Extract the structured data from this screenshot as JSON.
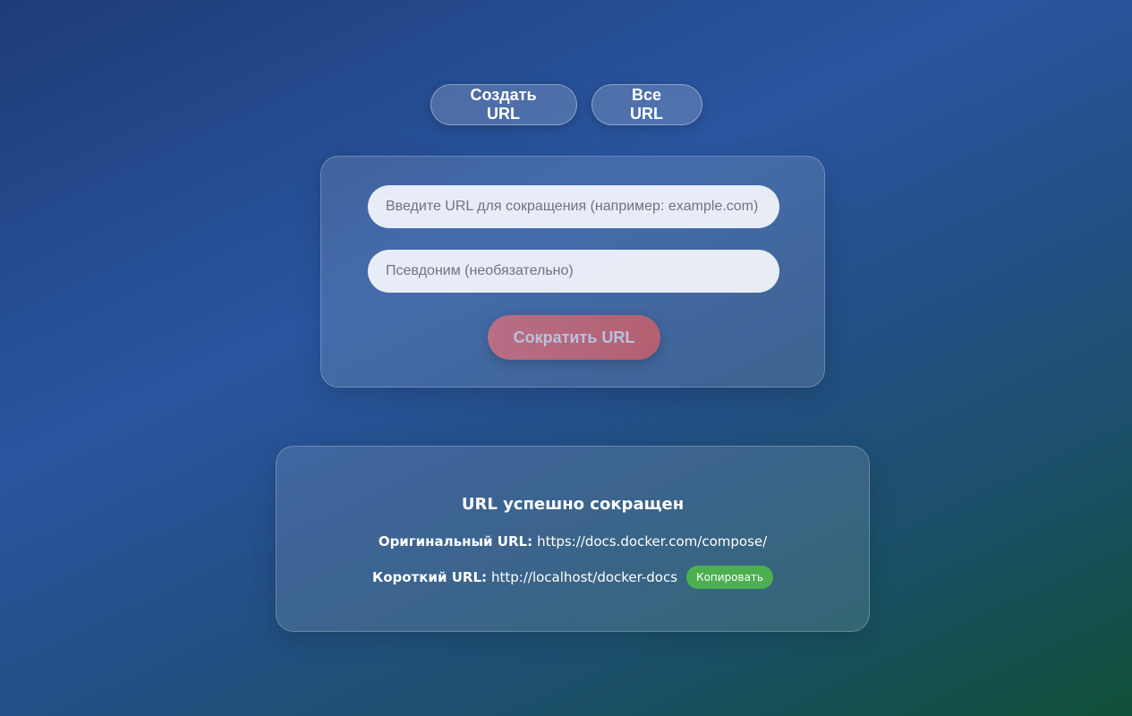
{
  "nav": {
    "create_label": "Создать URL",
    "all_label": "Все URL"
  },
  "form": {
    "url_placeholder": "Введите URL для сокращения (например: example.com)",
    "url_value": "",
    "alias_placeholder": "Псевдоним (необязательно)",
    "alias_value": "",
    "submit_label": "Сократить URL"
  },
  "result": {
    "title": "URL успешно сокращен",
    "original_label": "Оригинальный URL:",
    "original_value": "https://docs.docker.com/compose/",
    "short_label": "Короткий URL:",
    "short_value": "http://localhost/docker-docs",
    "copy_label": "Копировать"
  },
  "colors": {
    "copy_button": "#4caf50",
    "submit_button": "#b36070",
    "background_start": "#1e3c78",
    "background_end": "#0f5038"
  }
}
